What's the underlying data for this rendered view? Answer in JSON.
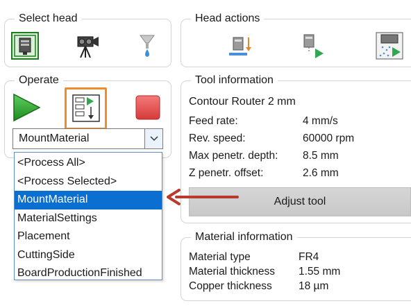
{
  "select_head": {
    "title": "Select head",
    "icons": [
      "milling-head-icon",
      "camera-head-icon",
      "dispenser-head-icon"
    ]
  },
  "head_actions": {
    "title": "Head actions",
    "icons": [
      "lower-head-icon",
      "move-head-icon",
      "head-clean-icon"
    ]
  },
  "operate": {
    "title": "Operate",
    "start_icon": "start-play-icon",
    "step_icon": "process-step-icon",
    "stop_icon": "stop-icon",
    "selected_value": "MountMaterial",
    "options": [
      "<Process All>",
      "<Process Selected>",
      "MountMaterial",
      "MaterialSettings",
      "Placement",
      "CuttingSide",
      "BoardProductionFinished"
    ],
    "highlighted_index": 2
  },
  "tool_information": {
    "title": "Tool information",
    "tool_name": "Contour Router 2 mm",
    "rows": [
      {
        "label": "Feed rate:",
        "value": "4 mm/s"
      },
      {
        "label": "Rev. speed:",
        "value": "60000 rpm"
      },
      {
        "label": "Max penetr. depth:",
        "value": "8.5 mm"
      },
      {
        "label": "Z penetr. offset:",
        "value": "2.6 mm"
      }
    ],
    "adjust_button": "Adjust tool"
  },
  "material_information": {
    "title": "Material information",
    "rows": [
      {
        "label": "Material type",
        "value": "FR4"
      },
      {
        "label": "Material thickness",
        "value": "1.55 mm"
      },
      {
        "label": "Copper thickness",
        "value": "18 µm"
      }
    ]
  },
  "colors": {
    "highlight_orange": "#f08c2a",
    "annotation_arrow": "#b83a2c",
    "selection_blue": "#0a6fd0",
    "play_green": "#2a9a2a",
    "stop_red": "#e04848"
  }
}
